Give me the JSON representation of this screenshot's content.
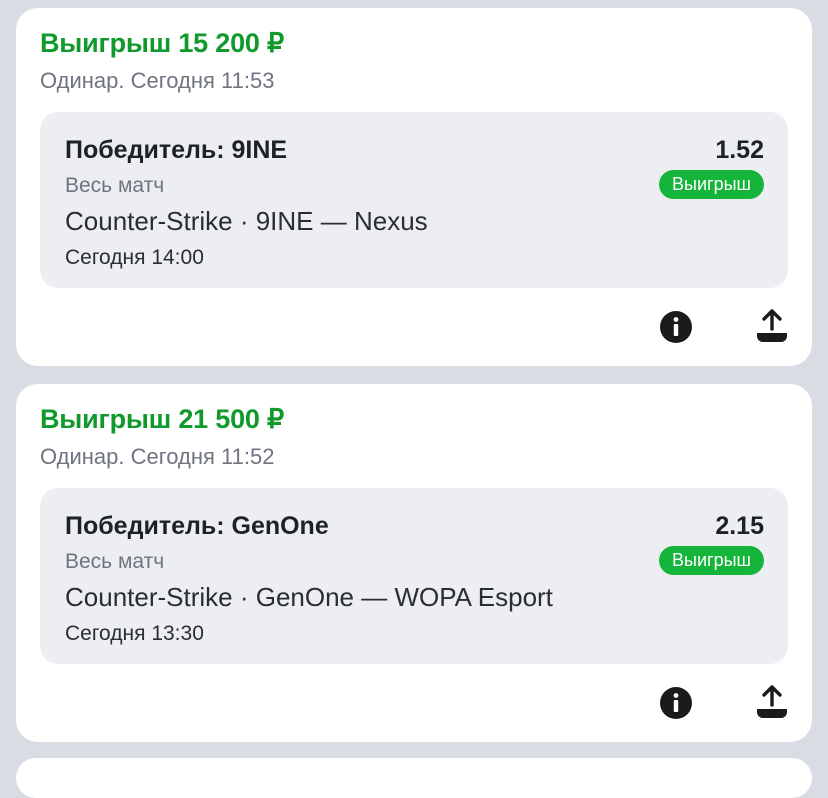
{
  "bets": [
    {
      "win_title": "Выигрыш 15 200 ₽",
      "meta": "Одинар. Сегодня 11:53",
      "market": "Победитель: 9INE",
      "odds": "1.52",
      "period": "Весь матч",
      "status": "Выигрыш",
      "event": "Counter-Strike · 9INE — Nexus",
      "time": "Сегодня 14:00",
      "icons": [
        "info-icon",
        "share-icon"
      ]
    },
    {
      "win_title": "Выигрыш 21 500 ₽",
      "meta": "Одинар. Сегодня 11:52",
      "market": "Победитель: GenOne",
      "odds": "2.15",
      "period": "Весь матч",
      "status": "Выигрыш",
      "event": "Counter-Strike · GenOne — WOPA Esport",
      "time": "Сегодня 13:30",
      "icons": [
        "info-icon",
        "share-icon"
      ]
    }
  ],
  "colors": {
    "background": "#d9dde3",
    "card": "#ffffff",
    "win_green": "#0f9a2b",
    "badge_green": "#14b53a",
    "inner_box": "#eceef2"
  }
}
